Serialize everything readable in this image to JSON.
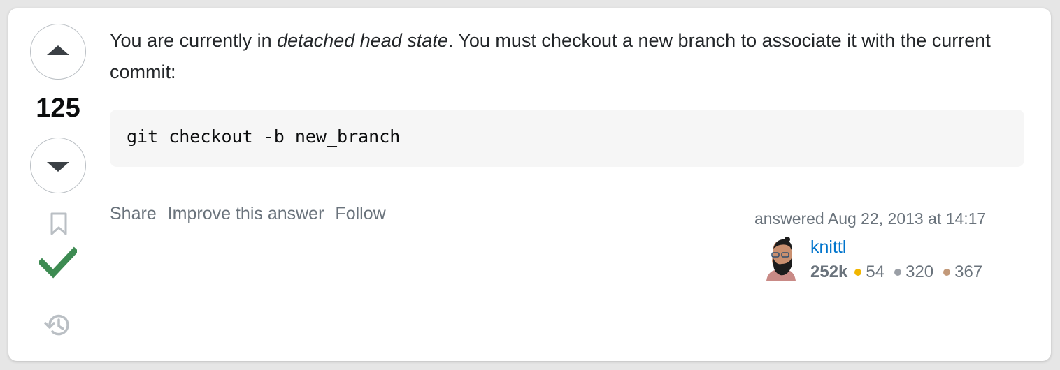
{
  "answer": {
    "score": "125",
    "text_before": "You are currently in ",
    "text_emphasis": "detached head state",
    "text_after": ". You must checkout a new branch to associate it with the current commit:",
    "code": "git checkout -b new_branch",
    "accepted": true,
    "actions": {
      "share": "Share",
      "improve": "Improve this answer",
      "follow": "Follow"
    }
  },
  "user_card": {
    "answered_label": "answered Aug 22, 2013 at 14:17",
    "user_name": "knittl",
    "reputation": "252k",
    "badges": {
      "gold": "54",
      "silver": "320",
      "bronze": "367"
    }
  },
  "colors": {
    "accepted_check": "#3d8b52",
    "link_blue": "#0074cc",
    "gold": "#f1b600",
    "silver": "#9a9fa6",
    "bronze": "#c29979",
    "muted_text": "#6a737c"
  },
  "icons": [
    "arrow-up-icon",
    "arrow-down-icon",
    "bookmark-icon",
    "accepted-check-icon",
    "history-icon"
  ]
}
